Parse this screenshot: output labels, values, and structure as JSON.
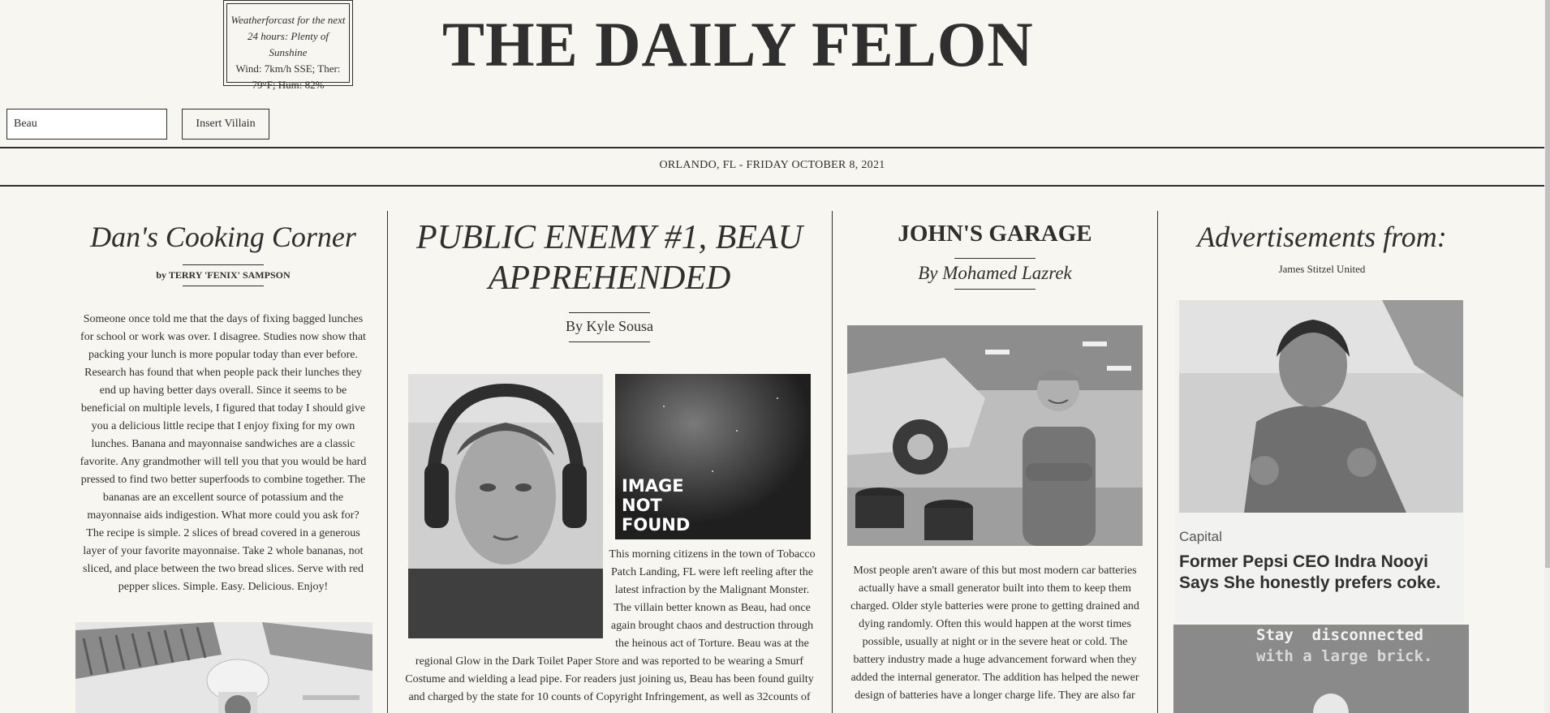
{
  "weather": {
    "forecast": "Weatherforcast for the next 24 hours: Plenty of Sunshine",
    "conditions": "Wind: 7km/h SSE; Ther: 79°F; Hum: 82%"
  },
  "masthead": {
    "title": "THE DAILY FELON"
  },
  "villain_form": {
    "input_value": "Beau",
    "button_label": "Insert Villain"
  },
  "dateline": "ORLANDO, FL - FRIDAY OCTOBER 8, 2021",
  "columns": {
    "cooking": {
      "heading": "Dan's Cooking Corner",
      "byline": "by TERRY 'FENIX' SAMPSON",
      "body": "Someone once told me that the days of fixing bagged lunches for school or work was over. I disagree. Studies now show that packing your lunch is more popular today than ever before. Research has found that when people pack their lunches they end up having better days overall. Since it seems to be beneficial on multiple levels, I figured that today I should give you a delicious little recipe that I enjoy fixing for my own lunches. Banana and mayonnaise sandwiches are a classic favorite. Any grandmother will tell you that you would be hard pressed to find two better superfoods to combine together. The bananas are an excellent source of potassium and the mayonnaise aids indigestion. What more could you ask for? The recipe is simple. 2 slices of bread covered in a generous layer of your favorite mayonnaise. Take 2 whole bananas, not sliced, and place between the two bread slices. Serve with red pepper slices. Simple. Easy. Delicious. Enjoy!"
    },
    "main": {
      "heading": "PUBLIC ENEMY #1, BEAU APPREHENDED",
      "byline": "By Kyle Sousa",
      "image_not_found": "IMAGE\nNOT\nFOUND",
      "body_right": "This morning citizens in the town of Tobacco Patch Landing, FL were left reeling after the latest infraction by the Malignant Monster. The villain better known as Beau, had once again brought chaos and destruction through the heinous act of Torture. Beau was at the",
      "body_full": "regional Glow in the Dark Toilet Paper Store and was reported to be wearing a Smurf Costume and wielding a lead pipe. For readers just joining us, Beau has been found guilty and charged by the state for 10 counts of Copyright Infringement, as well as 32counts of"
    },
    "garage": {
      "heading": "JOHN'S GARAGE",
      "byline": "By Mohamed Lazrek",
      "body": "Most people aren't aware of this but most modern car batteries actually have a small generator built into them to keep them charged. Older style batteries were prone to getting drained and dying randomly. Often this would happen at the worst times possible, usually at night or in the severe heat or cold. The battery industry made a huge advancement forward when they added the internal generator. The addition has helped the newer design of batteries have a longer charge life. They are also far"
    },
    "ads": {
      "heading": "Advertisements from:",
      "sponsor": "James Stitzel United",
      "ad1_source": "Capital",
      "ad1_title": "Former Pepsi CEO Indra Nooyi Says She honestly prefers coke.",
      "ad2_line1": "Stay  disconnected",
      "ad2_line2": "with a large brick."
    }
  },
  "colors": {
    "paper": "#f7f6f1",
    "ink": "#2f2f2f"
  }
}
